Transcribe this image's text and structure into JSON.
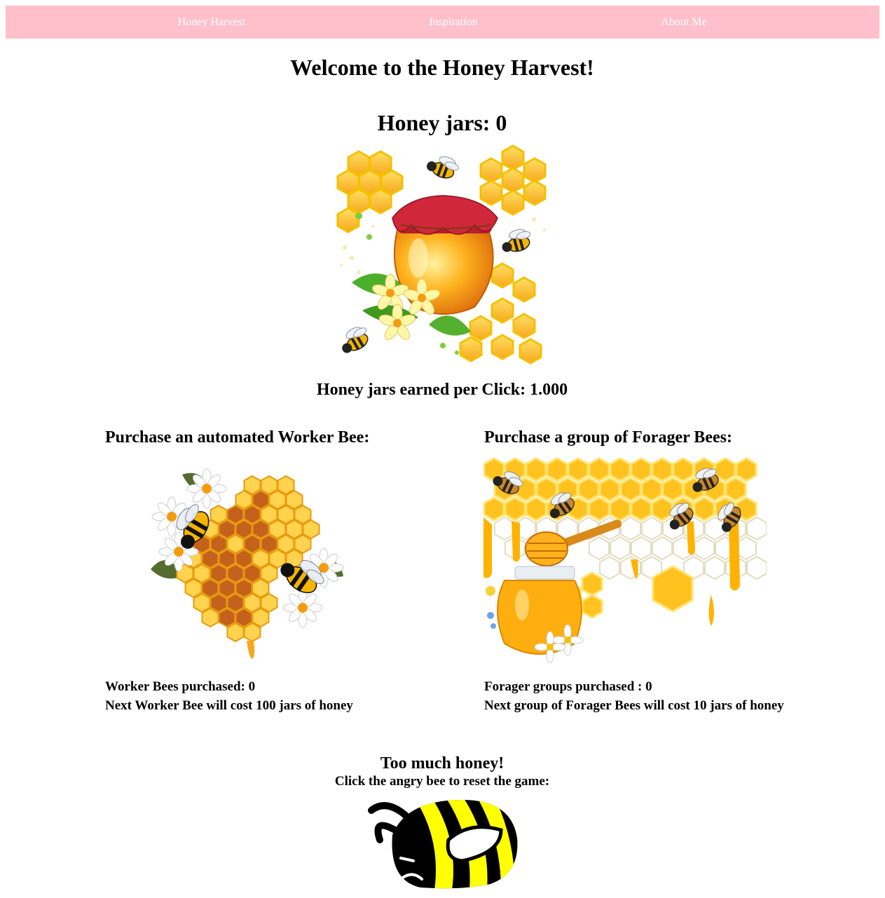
{
  "nav": {
    "items": [
      "Honey Harvest",
      "Inspiration",
      "About Me"
    ]
  },
  "welcome_title": "Welcome to the Honey Harvest!",
  "counter": {
    "label": "Honey jars: 0"
  },
  "per_click": "Honey jars earned per Click: 1.000",
  "worker": {
    "heading": "Purchase an automated Worker Bee:",
    "purchased": "Worker Bees purchased: 0",
    "cost": "Next Worker Bee will cost 100 jars of honey"
  },
  "forager": {
    "heading": "Purchase a group of Forager Bees:",
    "purchased": "Forager groups purchased : 0",
    "cost": "Next group of Forager Bees will cost 10 jars of honey"
  },
  "reset": {
    "title": "Too much honey!",
    "instruction": "Click the angry bee to reset the game:"
  },
  "colors": {
    "nav_bg": "#ffc0cb",
    "honey": "#f7a81b",
    "honey_light": "#ffd34d",
    "bee_yellow": "#ffff00"
  },
  "icons": [
    "honey-jar-icon",
    "worker-bee-honeycomb-icon",
    "forager-bees-honeycomb-icon",
    "angry-bee-icon"
  ]
}
